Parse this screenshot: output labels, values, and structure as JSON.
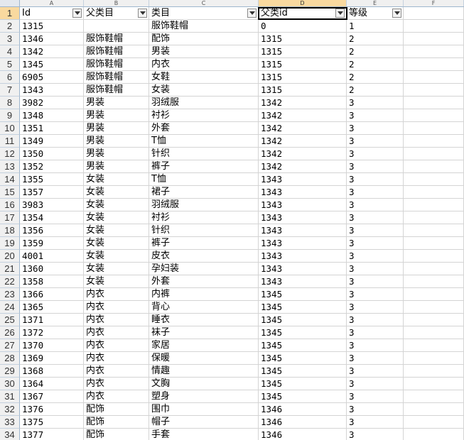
{
  "columns": [
    "A",
    "B",
    "C",
    "D",
    "E",
    "F"
  ],
  "selected_column": "D",
  "header_row": {
    "row_number": "1",
    "cells": [
      "Id",
      "父类目",
      "类目",
      "父类id",
      "等级"
    ]
  },
  "rows": [
    {
      "n": "2",
      "a": "1315",
      "b": "",
      "c": "服饰鞋帽",
      "d": "0",
      "e": "1"
    },
    {
      "n": "3",
      "a": "1346",
      "b": "服饰鞋帽",
      "c": "配饰",
      "d": "1315",
      "e": "2"
    },
    {
      "n": "4",
      "a": "1342",
      "b": "服饰鞋帽",
      "c": "男装",
      "d": "1315",
      "e": "2"
    },
    {
      "n": "5",
      "a": "1345",
      "b": "服饰鞋帽",
      "c": "内衣",
      "d": "1315",
      "e": "2"
    },
    {
      "n": "6",
      "a": "6905",
      "b": "服饰鞋帽",
      "c": "女鞋",
      "d": "1315",
      "e": "2"
    },
    {
      "n": "7",
      "a": "1343",
      "b": "服饰鞋帽",
      "c": "女装",
      "d": "1315",
      "e": "2"
    },
    {
      "n": "8",
      "a": "3982",
      "b": "男装",
      "c": "羽绒服",
      "d": "1342",
      "e": "3"
    },
    {
      "n": "9",
      "a": "1348",
      "b": "男装",
      "c": "衬衫",
      "d": "1342",
      "e": "3"
    },
    {
      "n": "10",
      "a": "1351",
      "b": "男装",
      "c": "外套",
      "d": "1342",
      "e": "3"
    },
    {
      "n": "11",
      "a": "1349",
      "b": "男装",
      "c": "T恤",
      "d": "1342",
      "e": "3"
    },
    {
      "n": "12",
      "a": "1350",
      "b": "男装",
      "c": "针织",
      "d": "1342",
      "e": "3"
    },
    {
      "n": "13",
      "a": "1352",
      "b": "男装",
      "c": "裤子",
      "d": "1342",
      "e": "3"
    },
    {
      "n": "14",
      "a": "1355",
      "b": "女装",
      "c": "T恤",
      "d": "1343",
      "e": "3"
    },
    {
      "n": "15",
      "a": "1357",
      "b": "女装",
      "c": "裙子",
      "d": "1343",
      "e": "3"
    },
    {
      "n": "16",
      "a": "3983",
      "b": "女装",
      "c": "羽绒服",
      "d": "1343",
      "e": "3"
    },
    {
      "n": "17",
      "a": "1354",
      "b": "女装",
      "c": "衬衫",
      "d": "1343",
      "e": "3"
    },
    {
      "n": "18",
      "a": "1356",
      "b": "女装",
      "c": "针织",
      "d": "1343",
      "e": "3"
    },
    {
      "n": "19",
      "a": "1359",
      "b": "女装",
      "c": "裤子",
      "d": "1343",
      "e": "3"
    },
    {
      "n": "20",
      "a": "4001",
      "b": "女装",
      "c": "皮衣",
      "d": "1343",
      "e": "3"
    },
    {
      "n": "21",
      "a": "1360",
      "b": "女装",
      "c": "孕妇装",
      "d": "1343",
      "e": "3"
    },
    {
      "n": "22",
      "a": "1358",
      "b": "女装",
      "c": "外套",
      "d": "1343",
      "e": "3"
    },
    {
      "n": "23",
      "a": "1366",
      "b": "内衣",
      "c": "内裤",
      "d": "1345",
      "e": "3"
    },
    {
      "n": "24",
      "a": "1365",
      "b": "内衣",
      "c": "背心",
      "d": "1345",
      "e": "3"
    },
    {
      "n": "25",
      "a": "1371",
      "b": "内衣",
      "c": "睡衣",
      "d": "1345",
      "e": "3"
    },
    {
      "n": "26",
      "a": "1372",
      "b": "内衣",
      "c": "袜子",
      "d": "1345",
      "e": "3"
    },
    {
      "n": "27",
      "a": "1370",
      "b": "内衣",
      "c": "家居",
      "d": "1345",
      "e": "3"
    },
    {
      "n": "28",
      "a": "1369",
      "b": "内衣",
      "c": "保暖",
      "d": "1345",
      "e": "3"
    },
    {
      "n": "29",
      "a": "1368",
      "b": "内衣",
      "c": "情趣",
      "d": "1345",
      "e": "3"
    },
    {
      "n": "30",
      "a": "1364",
      "b": "内衣",
      "c": "文胸",
      "d": "1345",
      "e": "3"
    },
    {
      "n": "31",
      "a": "1367",
      "b": "内衣",
      "c": "塑身",
      "d": "1345",
      "e": "3"
    },
    {
      "n": "32",
      "a": "1376",
      "b": "配饰",
      "c": "围巾",
      "d": "1346",
      "e": "3"
    },
    {
      "n": "33",
      "a": "1375",
      "b": "配饰",
      "c": "帽子",
      "d": "1346",
      "e": "3"
    },
    {
      "n": "34",
      "a": "1377",
      "b": "配饰",
      "c": "手套",
      "d": "1346",
      "e": "3"
    }
  ],
  "filter_icon": "dropdown-arrow-icon",
  "colors": {
    "header_bg": "#f0f0f0",
    "selected_header_bg": "#f9d99f",
    "grid": "#d4d4d4"
  }
}
